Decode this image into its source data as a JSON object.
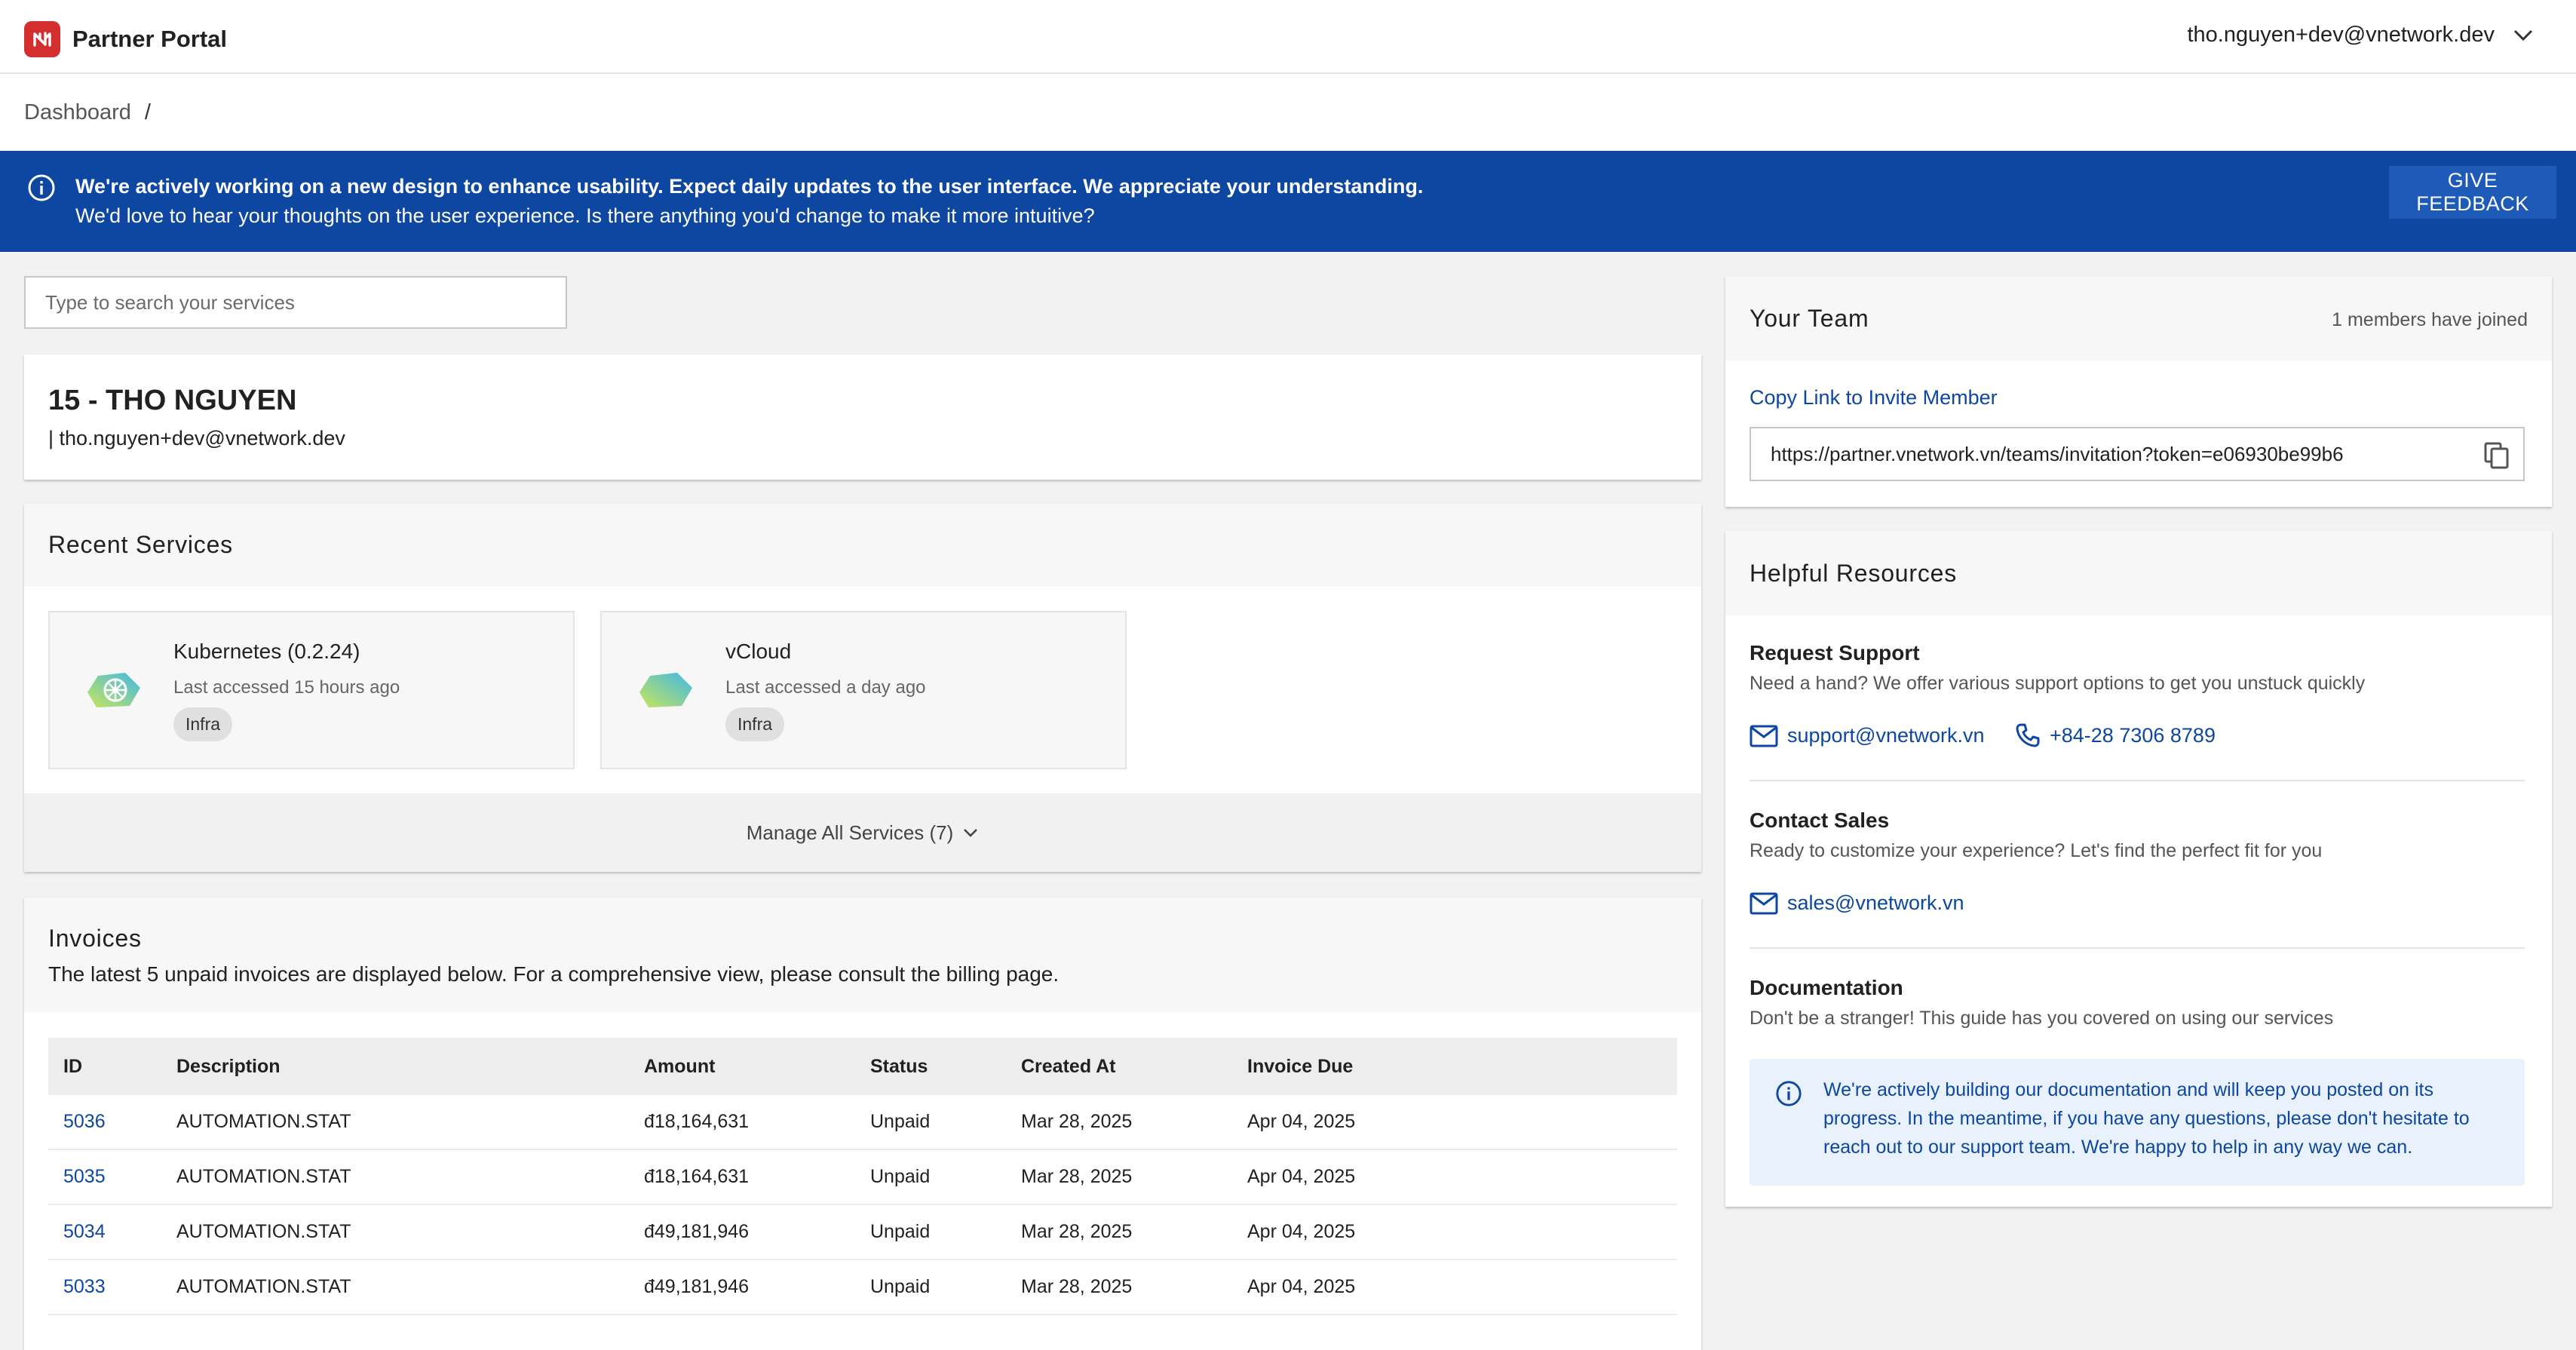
{
  "app": {
    "title": "Partner Portal"
  },
  "user": {
    "email": "tho.nguyen+dev@vnetwork.dev"
  },
  "breadcrumb": {
    "items": [
      "Dashboard"
    ],
    "separator": "/"
  },
  "banner": {
    "line1": "We're actively working on a new design to enhance usability. Expect daily updates to the user interface. We appreciate your understanding.",
    "line2": "We'd love to hear your thoughts on the user experience. Is there anything you'd change to make it more intuitive?",
    "button": "GIVE FEEDBACK"
  },
  "search": {
    "placeholder": "Type to search your services"
  },
  "profile": {
    "name": "15 - THO NGUYEN",
    "email": "| tho.nguyen+dev@vnetwork.dev"
  },
  "recent_services": {
    "title": "Recent Services",
    "items": [
      {
        "name": "Kubernetes (0.2.24)",
        "last_accessed": "Last accessed 15 hours ago",
        "tag": "Infra",
        "icon": "kubernetes-icon"
      },
      {
        "name": "vCloud",
        "last_accessed": "Last accessed a day ago",
        "tag": "Infra",
        "icon": "cloud-icon"
      }
    ],
    "manage_label": "Manage All Services (7)"
  },
  "invoices": {
    "title": "Invoices",
    "subtitle": "The latest 5 unpaid invoices are displayed below. For a comprehensive view, please consult the billing page.",
    "columns": [
      "ID",
      "Description",
      "Amount",
      "Status",
      "Created At",
      "Invoice Due"
    ],
    "rows": [
      [
        "5036",
        "AUTOMATION.STAT",
        "đ18,164,631",
        "Unpaid",
        "Mar 28, 2025",
        "Apr 04, 2025"
      ],
      [
        "5035",
        "AUTOMATION.STAT",
        "đ18,164,631",
        "Unpaid",
        "Mar 28, 2025",
        "Apr 04, 2025"
      ],
      [
        "5034",
        "AUTOMATION.STAT",
        "đ49,181,946",
        "Unpaid",
        "Mar 28, 2025",
        "Apr 04, 2025"
      ],
      [
        "5033",
        "AUTOMATION.STAT",
        "đ49,181,946",
        "Unpaid",
        "Mar 28, 2025",
        "Apr 04, 2025"
      ]
    ]
  },
  "team": {
    "title": "Your Team",
    "members_joined": "1 members have joined",
    "invite_label": "Copy Link to Invite Member",
    "invite_url": "https://partner.vnetwork.vn/teams/invitation?token=e06930be99b6"
  },
  "resources": {
    "title": "Helpful Resources",
    "support": {
      "title": "Request Support",
      "desc": "Need a hand? We offer various support options to get you unstuck quickly",
      "email": "support@vnetwork.vn",
      "phone": "+84-28 7306 8789"
    },
    "sales": {
      "title": "Contact Sales",
      "desc": "Ready to customize your experience? Let's find the perfect fit for you",
      "email": "sales@vnetwork.vn"
    },
    "docs": {
      "title": "Documentation",
      "desc": "Don't be a stranger! This guide has you covered on using our services",
      "note": "We're actively building our documentation and will keep you posted on its progress. In the meantime, if you have any questions, please don't hesitate to reach out to our support team. We're happy to help in any way we can."
    }
  },
  "colors": {
    "brand": "#d32f2f",
    "banner": "#0d47a1",
    "link": "#0d47a1",
    "page_bg": "#f1f2f1"
  }
}
